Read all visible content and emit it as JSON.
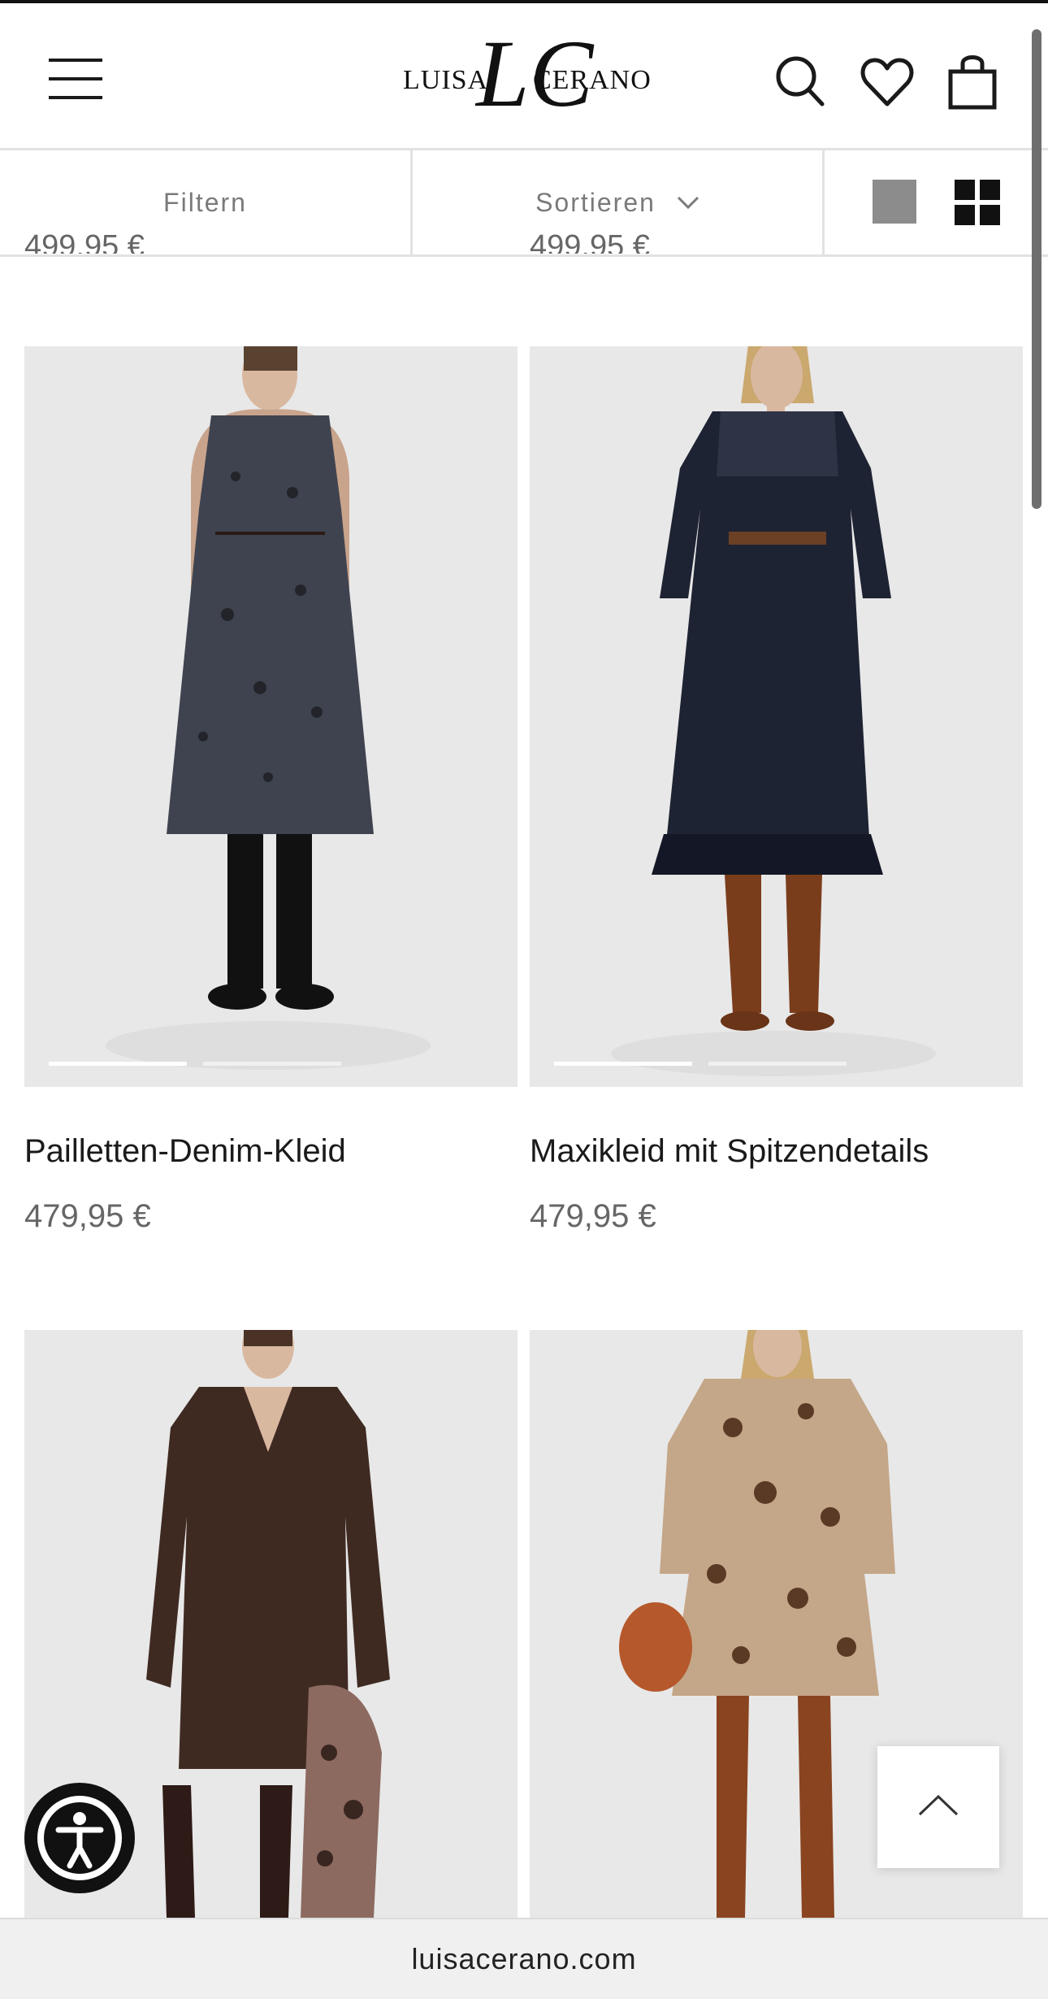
{
  "header": {
    "logo_word_left": "LUISA",
    "logo_word_right": "CERANO",
    "logo_monogram": "LC",
    "menu_icon": "hamburger-menu-icon",
    "search_icon": "search-icon",
    "wishlist_icon": "heart-icon",
    "cart_icon": "shopping-bag-icon"
  },
  "toolbar": {
    "filter_label": "Filtern",
    "sort_label": "Sortieren",
    "view_single_icon": "single-column-view-icon",
    "view_grid_icon": "grid-view-icon"
  },
  "previous_row": {
    "cut_prices": [
      "499,95 €",
      "499,95 €"
    ]
  },
  "products": [
    {
      "name": "Pailletten-Denim-Kleid",
      "price": "479,95 €",
      "image_slides": 2,
      "active_slide": 1
    },
    {
      "name": "Maxikleid mit Spitzendetails",
      "price": "479,95 €",
      "image_slides": 2,
      "active_slide": 1
    },
    {
      "name": "",
      "price": ""
    },
    {
      "name": "",
      "price": ""
    }
  ],
  "floating": {
    "accessibility_icon": "accessibility-icon",
    "back_to_top_icon": "chevron-up-icon"
  },
  "browser": {
    "url": "luisacerano.com"
  },
  "colors": {
    "text": "#1a1a1a",
    "price": "#666666",
    "toolbar_text": "#7a7a7a",
    "divider": "#e2e2e2"
  }
}
